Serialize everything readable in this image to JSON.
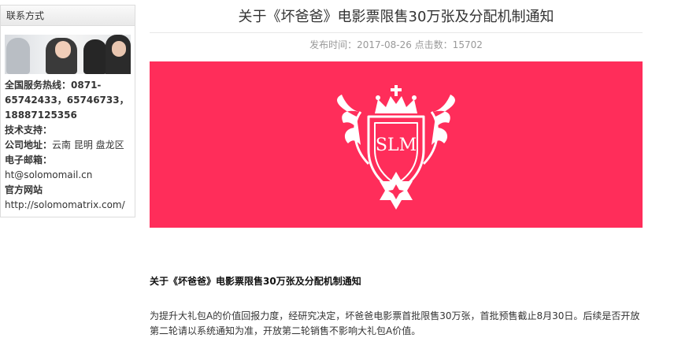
{
  "sidebar": {
    "header": "联系方式",
    "hotline_label": "全国服务热线：",
    "hotline_value": "0871-65742433，65746733，18887125356",
    "tech_label": "技术支持：",
    "address_label": "公司地址：",
    "address_value": "云南 昆明 盘龙区",
    "email_label": "电子邮箱：",
    "email_value": "ht@solomomail.cn",
    "website_label": "官方网站",
    "website_value": "http://solomomatrix.com/"
  },
  "article": {
    "title": "关于《坏爸爸》电影票限售30万张及分配机制通知",
    "meta": "发布时间：2017-08-26 点击数：15702",
    "banner_logo_text": "SLM",
    "section_title": "关于《坏爸爸》电影票限售30万张及分配机制通知",
    "paragraph": "为提升大礼包A的价值回报力度，经研究决定，坏爸爸电影票首批限售30万张，首批预售截止8月30日。后续是否开放第二轮请以系统通知为准，开放第二轮销售不影响大礼包A价值。"
  },
  "colors": {
    "banner_bg": "#ff2d5a",
    "logo_fg": "#ffffff"
  }
}
